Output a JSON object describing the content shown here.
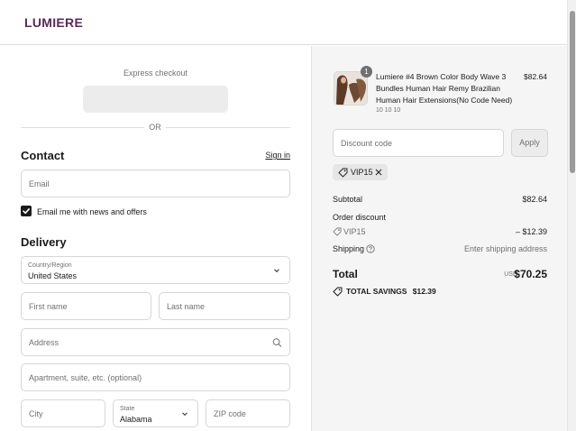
{
  "brand": {
    "logo_text": "LUMIERE",
    "accent_color": "#5a2a55"
  },
  "express": {
    "title": "Express checkout",
    "or_text": "OR"
  },
  "contact": {
    "heading": "Contact",
    "sign_in": "Sign in",
    "email_placeholder": "Email",
    "newsletter_label": "Email me with news and offers",
    "newsletter_checked": true
  },
  "delivery": {
    "heading": "Delivery",
    "country_label": "Country/Region",
    "country_value": "United States",
    "first_name_placeholder": "First name",
    "last_name_placeholder": "Last name",
    "address_placeholder": "Address",
    "apartment_placeholder": "Apartment, suite, etc. (optional)",
    "city_placeholder": "City",
    "state_label": "State",
    "state_value": "Alabama",
    "zip_placeholder": "ZIP code"
  },
  "summary": {
    "product": {
      "quantity": "1",
      "title": "Lumiere #4 Brown Color Body Wave 3 Bundles Human Hair Remy Brazilian Human Hair Extensions(No Code Need)",
      "variant": "10 10 10",
      "price": "$82.64"
    },
    "discount_placeholder": "Discount code",
    "apply_label": "Apply",
    "applied_code": "VIP15",
    "subtotal_label": "Subtotal",
    "subtotal_value": "$82.64",
    "order_discount_label": "Order discount",
    "discount_code_name": "VIP15",
    "discount_value": "– $12.39",
    "shipping_label": "Shipping",
    "shipping_value": "Enter shipping address",
    "total_label": "Total",
    "currency": "USD",
    "total_value": "$70.25",
    "savings_label": "TOTAL SAVINGS",
    "savings_value": "$12.39"
  }
}
